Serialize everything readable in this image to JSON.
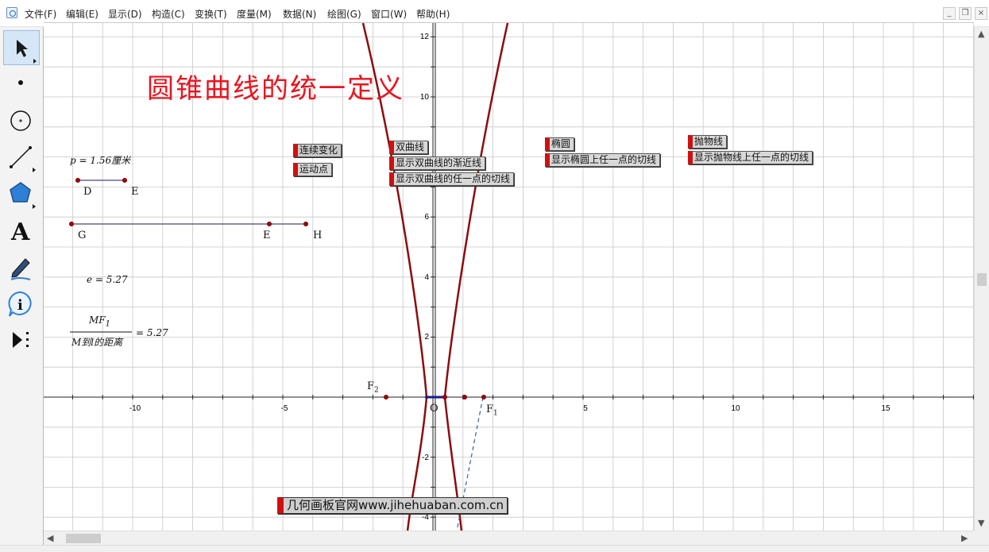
{
  "menu": {
    "items": [
      "文件(F)",
      "编辑(E)",
      "显示(D)",
      "构造(C)",
      "变换(T)",
      "度量(M)",
      "数据(N)",
      "绘图(G)",
      "窗口(W)",
      "帮助(H)"
    ],
    "window_controls": [
      "minimize-icon",
      "restore-icon",
      "close-icon"
    ]
  },
  "toolbox": {
    "tools": [
      "arrow-select-icon",
      "point-tool-icon",
      "compass-circle-icon",
      "straightedge-icon",
      "polygon-icon",
      "text-tool-icon",
      "marker-pen-icon",
      "information-icon",
      "custom-tools-icon"
    ],
    "text_tool_glyph": "A",
    "info_tool_glyph": "i"
  },
  "sketch": {
    "title": "圆锥曲线的统一定义",
    "measure_p": "p = 1.56厘米",
    "measure_e": "e = 5.27",
    "ratio_numerator": "MF",
    "ratio_numerator_sub": "1",
    "ratio_denominator": "M到l的距离",
    "ratio_value": "= 5.27",
    "segment_labels": [
      "D",
      "E",
      "G",
      "E",
      "H"
    ],
    "focus_labels": {
      "f2": "F",
      "f2_sub": "2",
      "f1": "F",
      "f1_sub": "1"
    },
    "origin_label": "O",
    "buttons": {
      "continuous_change": "连续变化",
      "move_point": "运动点",
      "hyperbola": "双曲线",
      "show_asymptotes": "显示双曲线的渐近线",
      "show_hyperbola_tangent": "显示双曲线的任一点的切线",
      "ellipse": "椭圆",
      "show_ellipse_tangent": "显示椭圆上任一点的切线",
      "parabola": "抛物线",
      "show_parabola_tangent": "显示抛物线上任一点的切线"
    },
    "watermark": "几何画板官网www.jihehuaban.com.cn"
  },
  "axes": {
    "x_ticks": [
      "-10",
      "-5",
      "5",
      "10",
      "15"
    ],
    "y_ticks": [
      "12",
      "10",
      "6",
      "4",
      "2",
      "-2",
      "-4"
    ]
  },
  "colors": {
    "curve": "#8b0d0d",
    "title": "#e8141e",
    "button_marker": "#d01010",
    "grid": "#c8c8c8"
  }
}
